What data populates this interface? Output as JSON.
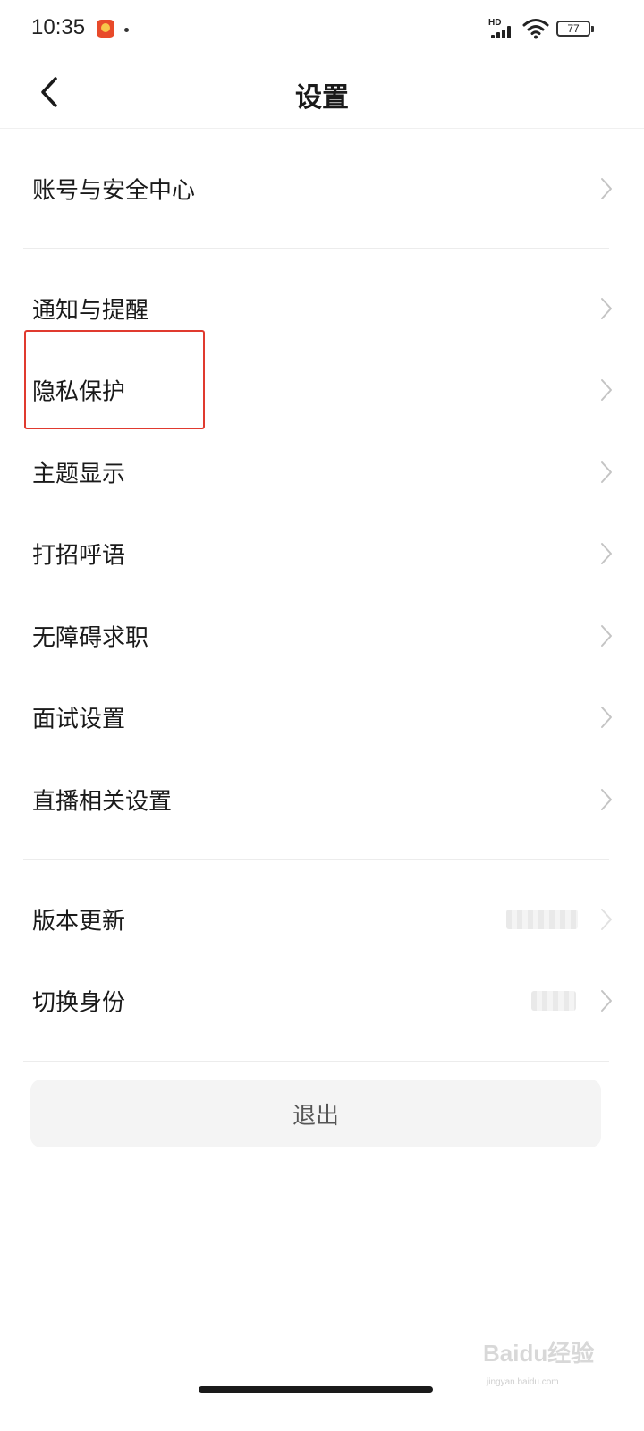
{
  "status_bar": {
    "time": "10:35",
    "hd_label": "HD",
    "battery": "77"
  },
  "header": {
    "title": "设置"
  },
  "sections": [
    {
      "items": [
        {
          "label": "账号与安全中心"
        }
      ]
    },
    {
      "items": [
        {
          "label": "通知与提醒"
        },
        {
          "label": "隐私保护"
        },
        {
          "label": "主题显示"
        },
        {
          "label": "打招呼语"
        },
        {
          "label": "无障碍求职"
        },
        {
          "label": "面试设置"
        },
        {
          "label": "直播相关设置"
        }
      ]
    },
    {
      "items": [
        {
          "label": "版本更新"
        },
        {
          "label": "切换身份"
        }
      ]
    }
  ],
  "logout_label": "退出",
  "watermark": {
    "brand": "Baidu经验",
    "url": "jingyan.baidu.com"
  },
  "colors": {
    "highlight": "#e03a2f",
    "background": "#ffffff",
    "button_bg": "#f4f4f4"
  }
}
